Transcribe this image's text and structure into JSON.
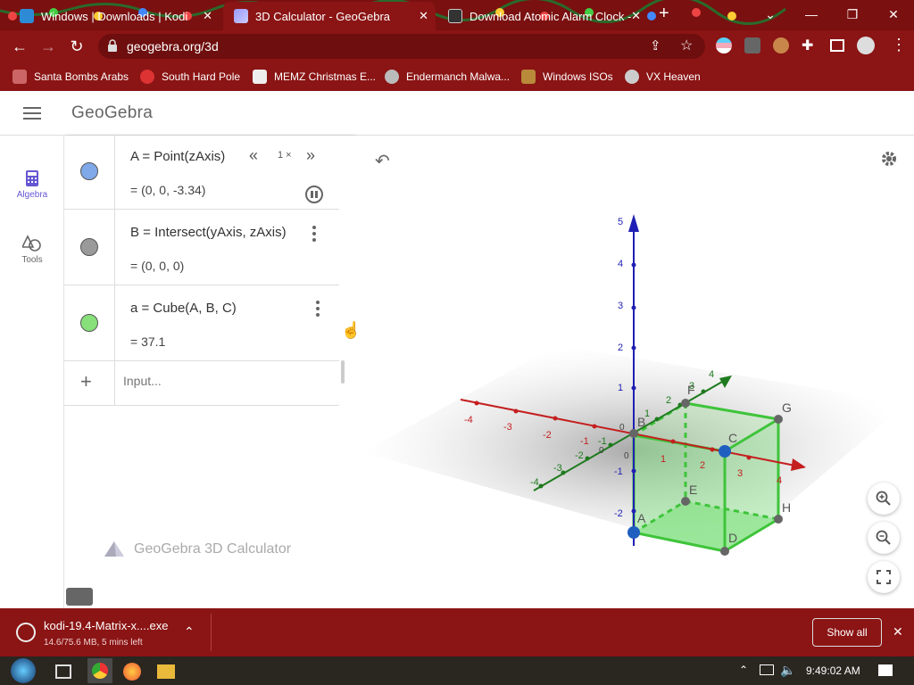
{
  "browser": {
    "tabs": [
      {
        "title": "Windows | Downloads | Kodi",
        "close": "✕"
      },
      {
        "title": "3D Calculator - GeoGebra",
        "close": "✕"
      },
      {
        "title": "Download Atomic Alarm Clock -",
        "close": "✕"
      }
    ],
    "new_tab": "+",
    "url": "geogebra.org/3d",
    "bookmarks": [
      {
        "label": "Santa Bombs Arabs"
      },
      {
        "label": "South Hard Pole"
      },
      {
        "label": "MEMZ Christmas E..."
      },
      {
        "label": "Endermanch Malwa..."
      },
      {
        "label": "Windows ISOs"
      },
      {
        "label": "VX Heaven"
      }
    ],
    "colors": {
      "frame": "#7a1010",
      "toolbar": "#8b1414"
    }
  },
  "app": {
    "logo": "GeoGebra",
    "rail": {
      "algebra": "Algebra",
      "tools": "Tools"
    },
    "watermark": "GeoGebra 3D Calculator",
    "input_placeholder": "Input..."
  },
  "algebra": {
    "items": [
      {
        "def": "A  =  Point(zAxis)",
        "value": "=  (0,  0,  -3.34)",
        "color": "#7fa9e8"
      },
      {
        "def": "B  =  Intersect(yAxis, zAxis)",
        "value": "=  (0,  0,  0)",
        "color": "#9a9a9a"
      },
      {
        "def": "a  =  Cube(A, B, C)",
        "value": "=  37.1",
        "color": "#88e07a"
      }
    ],
    "speed": "1 ×"
  },
  "view3d": {
    "z_ticks": [
      "5",
      "4",
      "3",
      "2",
      "1",
      "-1",
      "-2"
    ],
    "x_ticks": [
      "-4",
      "-3",
      "-2",
      "-1",
      "1",
      "2",
      "3",
      "4"
    ],
    "y_ticks": [
      "-4",
      "-3",
      "-2",
      "-1",
      "1",
      "2",
      "3",
      "4"
    ],
    "points": [
      "A",
      "B",
      "C",
      "D",
      "E",
      "F",
      "G",
      "H"
    ],
    "origin_labels": [
      "0",
      "0",
      "0"
    ]
  },
  "download": {
    "filename": "kodi-19.4-Matrix-x....exe",
    "status": "14.6/75.6 MB, 5 mins left",
    "show_all": "Show all",
    "close": "✕"
  },
  "taskbar": {
    "time": "9:49:02 AM"
  }
}
